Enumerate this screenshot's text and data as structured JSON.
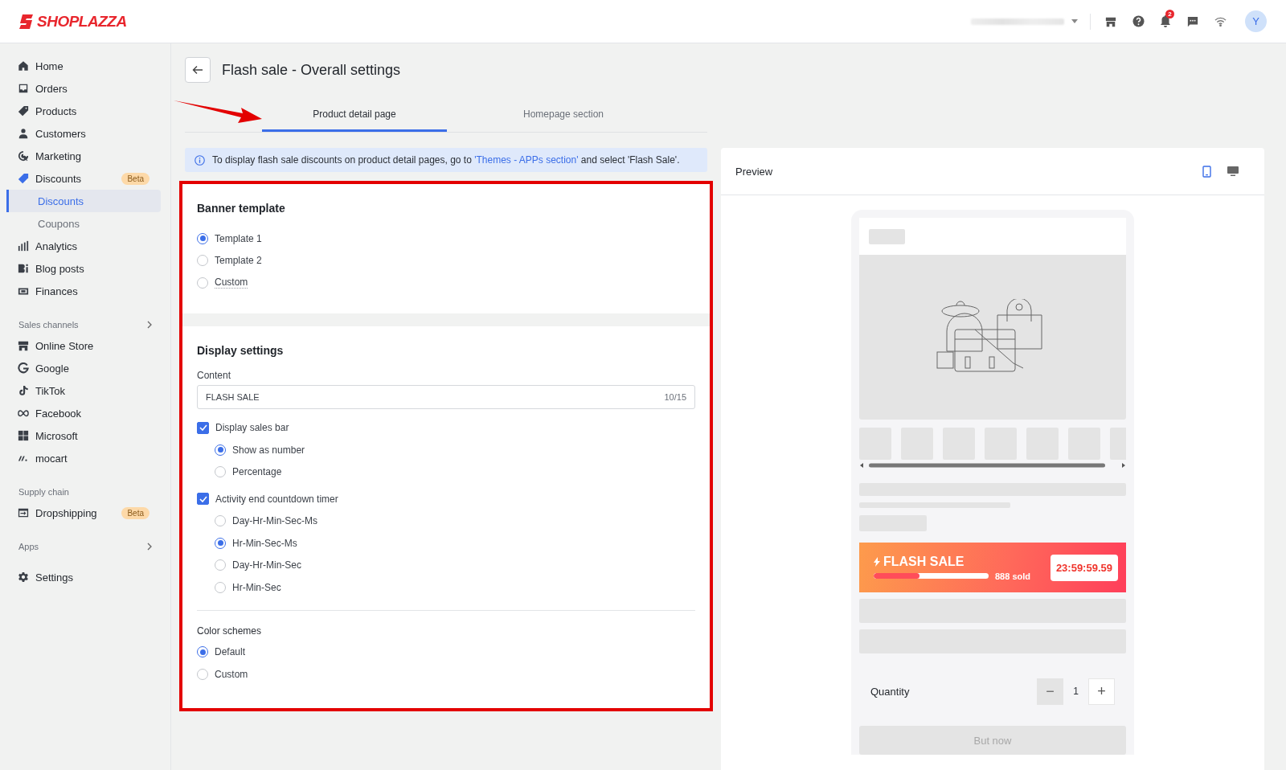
{
  "brand": "SHOPLAZZA",
  "topbar": {
    "notifications": "2",
    "avatar": "Y"
  },
  "sidebar": {
    "sections": [
      {
        "items": [
          {
            "label": "Home",
            "selected": false
          },
          {
            "label": "Orders",
            "selected": false
          },
          {
            "label": "Products",
            "selected": false
          },
          {
            "label": "Customers",
            "selected": false
          },
          {
            "label": "Marketing",
            "selected": false
          },
          {
            "label": "Discounts",
            "selected": false,
            "badge": "Beta",
            "children": [
              {
                "label": "Discounts",
                "selected": true
              },
              {
                "label": "Coupons",
                "selected": false
              }
            ]
          },
          {
            "label": "Analytics",
            "selected": false
          },
          {
            "label": "Blog posts",
            "selected": false
          },
          {
            "label": "Finances",
            "selected": false
          }
        ]
      },
      {
        "heading": "Sales channels",
        "chevron": true,
        "items": [
          {
            "label": "Online Store",
            "selected": false
          },
          {
            "label": "Google",
            "selected": false
          },
          {
            "label": "TikTok",
            "selected": false
          },
          {
            "label": "Facebook",
            "selected": false
          },
          {
            "label": "Microsoft",
            "selected": false
          },
          {
            "label": "mocart",
            "selected": false
          }
        ]
      },
      {
        "heading": "Supply chain",
        "chevron": false,
        "items": [
          {
            "label": "Dropshipping",
            "selected": false,
            "badge": "Beta"
          }
        ]
      },
      {
        "heading": "Apps",
        "chevron": true
      },
      {
        "items": [
          {
            "label": "Settings",
            "selected": false
          }
        ]
      }
    ]
  },
  "page_title": "Flash sale - Overall settings",
  "tabs": [
    {
      "label": "Product detail page",
      "selected": true
    },
    {
      "label": "Homepage section",
      "selected": false
    }
  ],
  "notice": {
    "before": "To display flash sale discounts on product detail pages, go to ",
    "link": "'Themes - APPs section'",
    "after": " and select 'Flash Sale'."
  },
  "banner_template": {
    "title": "Banner template",
    "options": [
      {
        "label": "Template 1",
        "selected": true,
        "hint": false
      },
      {
        "label": "Template 2",
        "selected": false,
        "hint": false
      },
      {
        "label": "Custom",
        "selected": false,
        "hint": true
      }
    ]
  },
  "display_settings": {
    "title": "Display settings",
    "content": {
      "label": "Content",
      "value": "FLASH SALE",
      "count": "10/15"
    },
    "sales_bar": {
      "label": "Display sales bar",
      "checked": true,
      "options": [
        {
          "label": "Show as number",
          "selected": true
        },
        {
          "label": "Percentage",
          "selected": false
        }
      ]
    },
    "countdown": {
      "label": "Activity end countdown timer",
      "checked": true,
      "options": [
        {
          "label": "Day-Hr-Min-Sec-Ms",
          "selected": false
        },
        {
          "label": "Hr-Min-Sec-Ms",
          "selected": true
        },
        {
          "label": "Day-Hr-Min-Sec",
          "selected": false
        },
        {
          "label": "Hr-Min-Sec",
          "selected": false
        }
      ]
    },
    "color_schemes": {
      "title": "Color schemes",
      "options": [
        {
          "label": "Default",
          "selected": true
        },
        {
          "label": "Custom",
          "selected": false
        }
      ]
    }
  },
  "preview": {
    "title": "Preview",
    "devices": [
      {
        "kind": "mobile",
        "selected": true
      },
      {
        "kind": "desktop",
        "selected": false
      }
    ],
    "banner": {
      "title": "FLASH SALE",
      "level": 0.4,
      "sold": "888 sold",
      "timer": "23:59:59.59"
    },
    "quantity": {
      "label": "Quantity",
      "value": "1",
      "minus": "−",
      "plus": "+"
    },
    "buy_button": "But now"
  }
}
